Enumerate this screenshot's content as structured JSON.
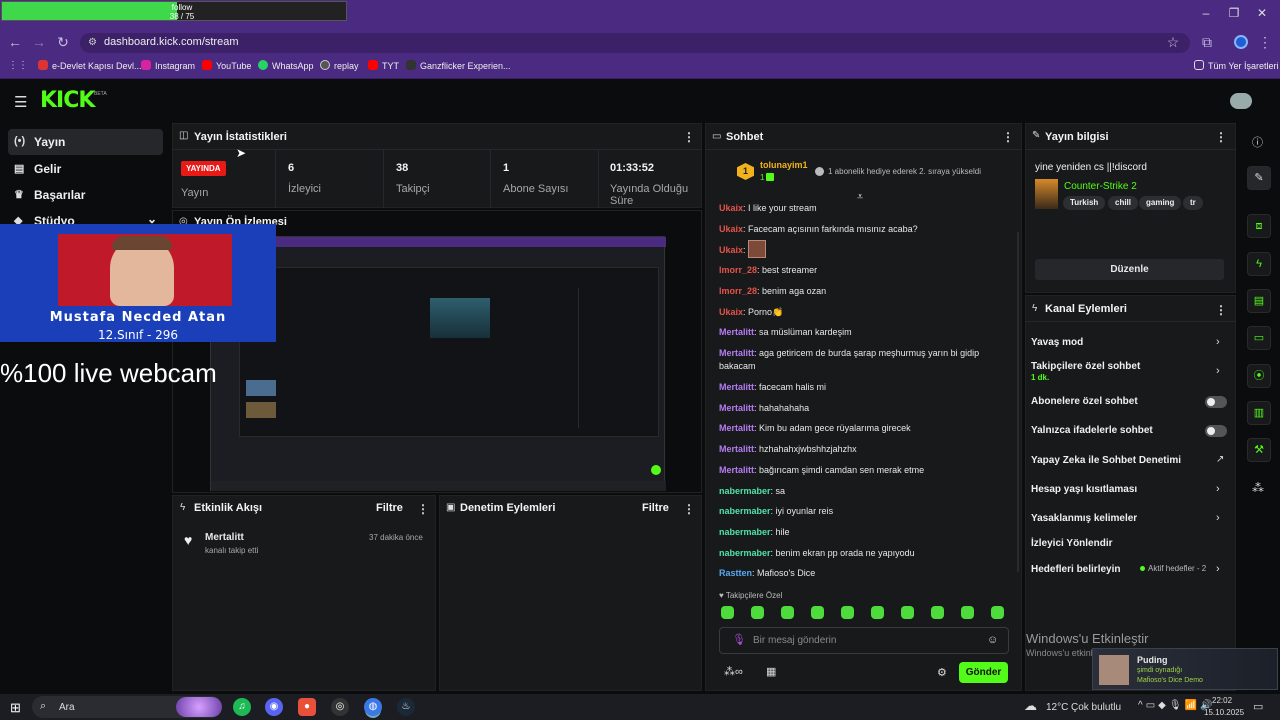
{
  "follow_goal": {
    "label": "follow",
    "count": "38 / 75"
  },
  "browser": {
    "url": "dashboard.kick.com/stream",
    "bookmarks": [
      "e-Devlet Kapısı Devl...",
      "Instagram",
      "YouTube",
      "WhatsApp",
      "replay",
      "TYT",
      "Ganzflicker Experien..."
    ],
    "all_bookmarks": "Tüm Yer İşaretleri"
  },
  "sidebar": {
    "items": [
      {
        "label": "Yayın",
        "icon": "broadcast-icon"
      },
      {
        "label": "Gelir",
        "icon": "revenue-icon"
      },
      {
        "label": "Başarılar",
        "icon": "trophy-icon"
      },
      {
        "label": "Stüdyo",
        "icon": "studio-icon"
      }
    ]
  },
  "stats": {
    "title": "Yayın İstatistikleri",
    "live_badge": "YAYINDA",
    "items": [
      {
        "value": "",
        "label": "Yayın"
      },
      {
        "value": "6",
        "label": "İzleyici"
      },
      {
        "value": "38",
        "label": "Takipçi"
      },
      {
        "value": "1",
        "label": "Abone Sayısı"
      },
      {
        "value": "01:33:52",
        "label": "Yayında Olduğu Süre"
      }
    ]
  },
  "preview": {
    "title": "Yayın Ön İzlemesi",
    "overlay_name": "Mustafa Necded Atan",
    "overlay_class": "12.Sınıf - 296",
    "overlay_text": "%100 live webcam"
  },
  "activity": {
    "title": "Etkinlik Akışı",
    "filter": "Filtre",
    "item_user": "Mertalitt",
    "item_text": "kanalı takip etti",
    "item_time": "37 dakika önce"
  },
  "moderation": {
    "title": "Denetim Eylemleri",
    "filter": "Filtre"
  },
  "chat": {
    "title": "Sohbet",
    "pinned_user": "tolunayim1",
    "pinned_count": "1",
    "pinned_text": "1 abonelik hediye ederek 2. sıraya yükseldi",
    "messages": [
      {
        "user": "Ukaix",
        "color": "#e5534b",
        "text": "I like your stream"
      },
      {
        "user": "Ukaix",
        "color": "#e5534b",
        "text": "Facecam açısının farkında mısınız acaba?"
      },
      {
        "user": "Ukaix",
        "color": "#e5534b",
        "text": ""
      },
      {
        "user": "lmorr_28",
        "color": "#e5534b",
        "text": "best streamer"
      },
      {
        "user": "lmorr_28",
        "color": "#e5534b",
        "text": "benim aga ozan"
      },
      {
        "user": "Ukaix",
        "color": "#e5534b",
        "text": "Porno👏"
      },
      {
        "user": "Mertalitt",
        "color": "#b57cf2",
        "text": "sa müslüman kardeşim"
      },
      {
        "user": "Mertalitt",
        "color": "#b57cf2",
        "text": "aga getiricem de burda şarap meşhurmuş yarın bi gidip"
      },
      {
        "user": "",
        "color": "#e8e8e8",
        "text": "bakacam"
      },
      {
        "user": "Mertalitt",
        "color": "#b57cf2",
        "text": "facecam halis mi"
      },
      {
        "user": "Mertalitt",
        "color": "#b57cf2",
        "text": "hahahahaha"
      },
      {
        "user": "Mertalitt",
        "color": "#b57cf2",
        "text": "Kim bu adam gece rüyalarıma girecek"
      },
      {
        "user": "Mertalitt",
        "color": "#b57cf2",
        "text": "hzhahahxjwbshhzjahzhx"
      },
      {
        "user": "Mertalitt",
        "color": "#b57cf2",
        "text": "bağırıcam şimdi camdan sen merak etme"
      },
      {
        "user": "nabermaber",
        "color": "#4de3a9",
        "text": "sa"
      },
      {
        "user": "nabermaber",
        "color": "#4de3a9",
        "text": "iyi oyunlar reis"
      },
      {
        "user": "nabermaber",
        "color": "#4de3a9",
        "text": "hile"
      },
      {
        "user": "nabermaber",
        "color": "#4de3a9",
        "text": "benim ekran pp orada ne yapıyodu"
      },
      {
        "user": "Rastten",
        "color": "#5aa8f0",
        "text": "Mafioso's Dice"
      }
    ],
    "followers_only": "Takipçilere Özel",
    "input_placeholder": "Bir mesaj gönderin",
    "send": "Gönder"
  },
  "stream_info": {
    "title": "Yayın bilgisi",
    "stream_title": "yine yeniden cs ||!discord",
    "category": "Counter-Strike 2",
    "tags": [
      "Turkish",
      "chill",
      "gaming",
      "tr"
    ],
    "edit": "Düzenle"
  },
  "channel_actions": {
    "title": "Kanal Eylemleri",
    "items": [
      {
        "label": "Yavaş mod",
        "sub": "",
        "control": "arrow"
      },
      {
        "label": "Takipçilere özel sohbet",
        "sub": "1 dk.",
        "control": "arrow"
      },
      {
        "label": "Abonelere özel sohbet",
        "sub": "",
        "control": "toggle"
      },
      {
        "label": "Yalnızca ifadelerle sohbet",
        "sub": "",
        "control": "toggle"
      },
      {
        "label": "Yapay Zeka ile Sohbet Denetimi",
        "sub": "",
        "control": "external"
      },
      {
        "label": "Hesap yaşı kısıtlaması",
        "sub": "",
        "control": "arrow"
      },
      {
        "label": "Yasaklanmış kelimeler",
        "sub": "",
        "control": "arrow"
      },
      {
        "label": "İzleyici Yönlendir",
        "sub": "",
        "control": "none"
      },
      {
        "label": "Hedefleri belirleyin",
        "sub": "",
        "control": "arrow"
      }
    ],
    "goals_status": "Aktif hedefler - 2"
  },
  "windows": {
    "activate_title": "Windows'u Etkinleştir",
    "activate_sub": "Windows'u etkinleştirmek için Ayarlar'a gidin."
  },
  "notification": {
    "user": "Puding",
    "status": "şimdi oynadığı",
    "game": "Mafioso's Dice Demo"
  },
  "taskbar": {
    "search": "Ara",
    "weather": "12°C",
    "weather_desc": "Çok bulutlu",
    "time": "22:02",
    "date": "15.10.2025"
  }
}
